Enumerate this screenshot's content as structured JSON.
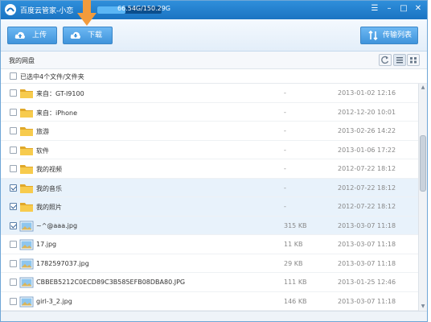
{
  "app": {
    "title": "百度云管家-小恋",
    "quota": "66.54G/150.29G",
    "quota_fraction": 0.44
  },
  "toolbar": {
    "upload_label": "上传",
    "download_label": "下载",
    "transfer_label": "传输列表"
  },
  "path": {
    "label": "我的网盘"
  },
  "selection": {
    "text": "已选中4个文件/文件夹"
  },
  "files": [
    {
      "name": "来自：GT-I9100",
      "size": "-",
      "date": "2013-01-02 12:16",
      "type": "folder",
      "checked": false
    },
    {
      "name": "来自：iPhone",
      "size": "-",
      "date": "2012-12-20 10:01",
      "type": "folder",
      "checked": false
    },
    {
      "name": "旅游",
      "size": "-",
      "date": "2013-02-26 14:22",
      "type": "folder",
      "checked": false
    },
    {
      "name": "软件",
      "size": "-",
      "date": "2013-01-06 17:22",
      "type": "folder",
      "checked": false
    },
    {
      "name": "我的视频",
      "size": "-",
      "date": "2012-07-22 18:12",
      "type": "folder",
      "checked": false
    },
    {
      "name": "我的音乐",
      "size": "-",
      "date": "2012-07-22 18:12",
      "type": "folder",
      "checked": true
    },
    {
      "name": "我的照片",
      "size": "-",
      "date": "2012-07-22 18:12",
      "type": "folder",
      "checked": true
    },
    {
      "name": "~^@aaa.jpg",
      "size": "315 KB",
      "date": "2013-03-07 11:18",
      "type": "image",
      "checked": true
    },
    {
      "name": "17.jpg",
      "size": "11 KB",
      "date": "2013-03-07 11:18",
      "type": "image",
      "checked": false
    },
    {
      "name": "1782597037.jpg",
      "size": "29 KB",
      "date": "2013-03-07 11:18",
      "type": "image",
      "checked": false
    },
    {
      "name": "CBBEB5212C0ECD89C3B585EFB08DBA80.JPG",
      "size": "111 KB",
      "date": "2013-01-25 12:46",
      "type": "image",
      "checked": false
    },
    {
      "name": "girl-3_2.jpg",
      "size": "146 KB",
      "date": "2013-03-07 11:18",
      "type": "image",
      "checked": false
    }
  ],
  "colors": {
    "titlebar": "#1f7fd0",
    "button": "#4a9fe0",
    "folder": "#f5c542",
    "selected_row": "#e8f2fb",
    "arrow": "#f29b3c"
  },
  "icons": {
    "logo": "baidu-cloud-logo-icon",
    "upload": "cloud-upload-icon",
    "download": "cloud-download-icon",
    "transfer": "transfer-arrows-icon",
    "refresh": "refresh-icon",
    "list_view": "list-view-icon",
    "grid_view": "grid-view-icon"
  }
}
